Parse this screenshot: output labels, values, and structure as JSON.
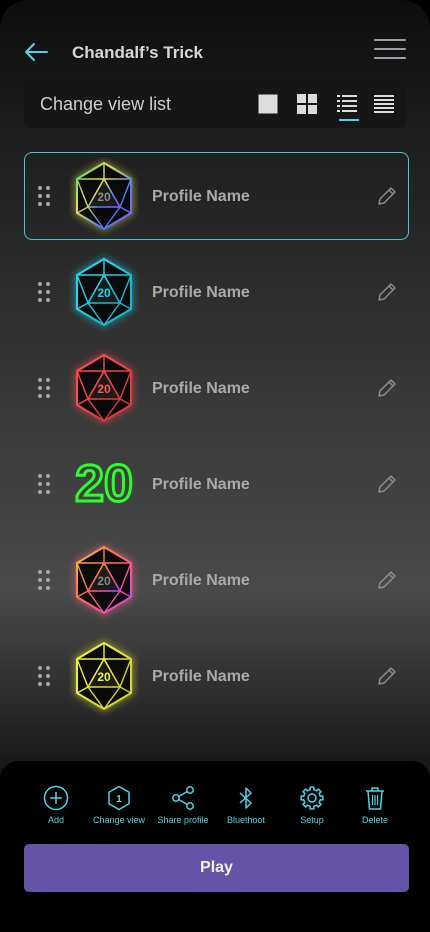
{
  "header": {
    "title": "Chandalf’s Trick"
  },
  "viewbar": {
    "label": "Change view list"
  },
  "profiles": [
    {
      "name": "Profile Name",
      "die_label": "20",
      "die_style": "rainbow"
    },
    {
      "name": "Profile Name",
      "die_label": "20",
      "die_style": "cyan"
    },
    {
      "name": "Profile Name",
      "die_label": "20",
      "die_style": "red"
    },
    {
      "name": "Profile Name",
      "die_label": "20",
      "die_style": "green-number"
    },
    {
      "name": "Profile Name",
      "die_label": "20",
      "die_style": "sunset"
    },
    {
      "name": "Profile Name",
      "die_label": "20",
      "die_style": "yellow"
    }
  ],
  "actions": [
    {
      "label": "Add",
      "icon": "plus-circle-icon"
    },
    {
      "label": "Change view",
      "icon": "hexagon-one-icon"
    },
    {
      "label": "Share profile",
      "icon": "share-icon"
    },
    {
      "label": "Bluethoot",
      "icon": "bluetooth-icon"
    },
    {
      "label": "Setup",
      "icon": "gear-icon"
    },
    {
      "label": "Delete",
      "icon": "trash-icon"
    }
  ],
  "play_label": "Play",
  "colors": {
    "accent": "#4fd4e8",
    "play": "#6453a6",
    "selected_border": "#46c6d4"
  }
}
